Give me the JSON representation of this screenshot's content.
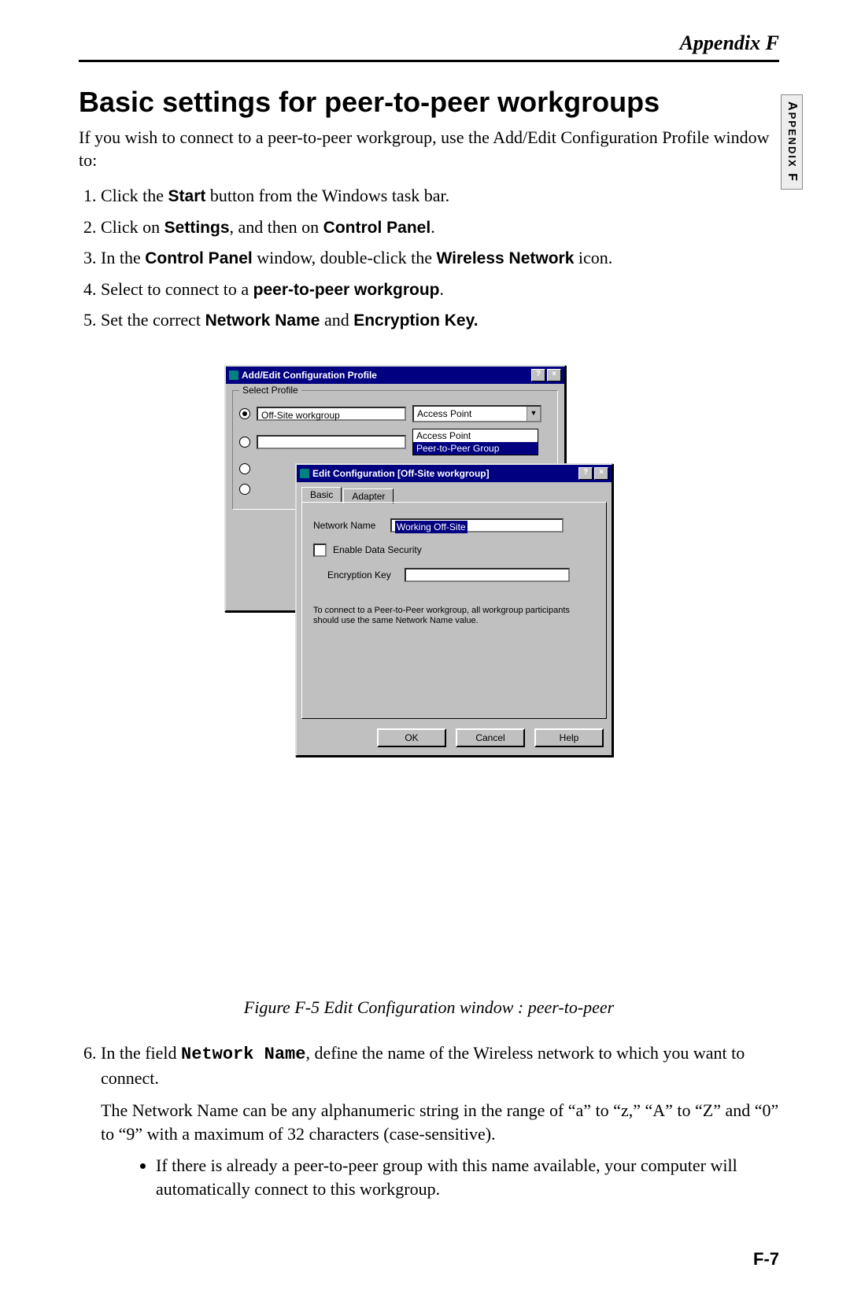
{
  "header": {
    "appendix": "Appendix F",
    "side_tab_top": "A",
    "side_tab_rest": "PPENDIX",
    "side_tab_end": " F"
  },
  "section": {
    "title": "Basic settings for peer-to-peer workgroups",
    "intro": "If you wish to connect to a peer-to-peer workgroup, use the Add/Edit Configuration Profile window to:"
  },
  "steps": {
    "s1_a": "Click the ",
    "s1_b": "Start",
    "s1_c": " button from the Windows task bar.",
    "s2_a": "Click on ",
    "s2_b": "Settings",
    "s2_c": ", and then on ",
    "s2_d": "Control Panel",
    "s2_e": ".",
    "s3_a": "In the ",
    "s3_b": "Control Panel",
    "s3_c": " window, double-click the ",
    "s3_d": "Wireless Network",
    "s3_e": " icon.",
    "s4_a": "Select to connect to a ",
    "s4_b": "peer-to-peer workgroup",
    "s4_c": ".",
    "s5_a": "Set the correct ",
    "s5_b": "Network Name",
    "s5_c": " and ",
    "s5_d": "Encryption Key."
  },
  "dialog1": {
    "title": "Add/Edit Configuration Profile",
    "group_label": "Select Profile",
    "profile0_value": "Off-Site workgroup",
    "drop_selected": "Access Point",
    "drop_opt1": "Access Point",
    "drop_opt2": "Peer-to-Peer Group"
  },
  "dialog2": {
    "title": "Edit Configuration [Off-Site workgroup]",
    "tab1": "Basic",
    "tab2": "Adapter",
    "label_network_name": "Network Name",
    "value_network_name": "Working Off-Site",
    "label_enable_sec": "Enable Data Security",
    "label_enc_key": "Encryption Key",
    "hint": "To connect to a Peer-to-Peer workgroup, all workgroup participants should use the same Network Name value.",
    "btn_ok": "OK",
    "btn_cancel": "Cancel",
    "btn_help": "Help"
  },
  "caption": "Figure F-5  Edit Configuration window : peer-to-peer",
  "cont": {
    "s6_a": "In the field ",
    "s6_b": "Network Name",
    "s6_c": ", define the name of the Wireless network to which you want to connect.",
    "s6_p": "The Network Name can be any alphanumeric string in the range of  “a” to “z,” “A” to “Z” and “0” to “9” with a maximum of 32 characters (case-sensitive).",
    "s6_bullet": "If there is already a peer-to-peer group with this name available, your computer will automatically connect to this workgroup."
  },
  "page_number": "F-7"
}
